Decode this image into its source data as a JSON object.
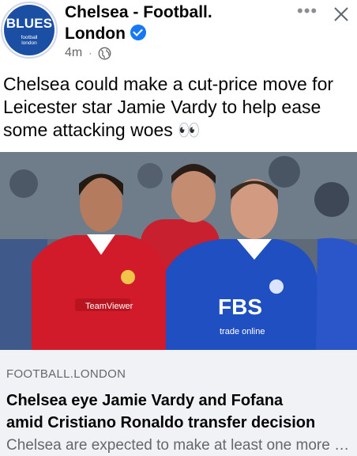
{
  "post": {
    "avatar_title": "BLUES",
    "avatar_sub_1": "football",
    "avatar_sub_2": "london",
    "page_name_line1": "Chelsea - Football.",
    "page_name_line2": "London",
    "timestamp": "4m",
    "separator": "·",
    "more_label": "•••",
    "text": "Chelsea could make a cut-price move for Leicester star Jamie Vardy to help ease some attacking woes 👀"
  },
  "photo": {
    "left_sponsor": "TeamViewer",
    "right_sponsor": "FBS",
    "right_sponsor_sub": "trade online"
  },
  "link": {
    "domain": "FOOTBALL.LONDON",
    "title_line1": "Chelsea eye Jamie Vardy and Fofana",
    "title_line2": "amid Cristiano Ronaldo transfer decision",
    "description": "Chelsea are expected to make at least one more signing"
  },
  "colors": {
    "brand_blue": "#1877f2",
    "united_red": "#d11a2a",
    "leicester_blue": "#1f4fc0"
  },
  "icons": [
    "globe-icon",
    "verified-icon",
    "more-icon",
    "close-icon"
  ]
}
